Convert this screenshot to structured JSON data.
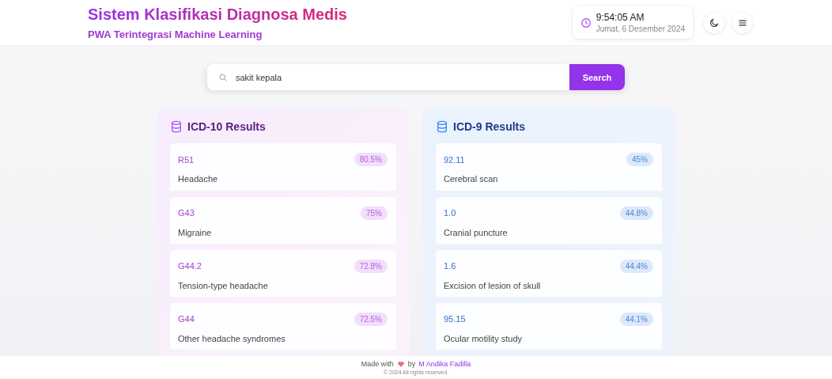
{
  "header": {
    "title": "Sistem Klasifikasi Diagnosa Medis",
    "subtitle": "PWA Terintegrasi Machine Learning",
    "time": "9:54:05 AM",
    "date": "Jumat, 6 Desember 2024"
  },
  "search": {
    "value": "sakit kepala",
    "button": "Search"
  },
  "panels": [
    {
      "kind": "icd10",
      "title": "ICD-10 Results",
      "results": [
        {
          "code": "R51",
          "name": "Headache",
          "score": "80.5%"
        },
        {
          "code": "G43",
          "name": "Migraine",
          "score": "75%"
        },
        {
          "code": "G44.2",
          "name": "Tension-type headache",
          "score": "72.8%"
        },
        {
          "code": "G44",
          "name": "Other headache syndromes",
          "score": "72.5%"
        }
      ]
    },
    {
      "kind": "icd9",
      "title": "ICD-9 Results",
      "results": [
        {
          "code": "92.11",
          "name": "Cerebral scan",
          "score": "45%"
        },
        {
          "code": "1.0",
          "name": "Cranial puncture",
          "score": "44.8%"
        },
        {
          "code": "1.6",
          "name": "Excision of lesion of skull",
          "score": "44.4%"
        },
        {
          "code": "95.15",
          "name": "Ocular motility study",
          "score": "44.1%"
        }
      ]
    }
  ],
  "footer": {
    "made_with": "Made with",
    "by": "by",
    "author": "M Andika Fadilla",
    "copyright": "© 2024 All rights reserved."
  }
}
